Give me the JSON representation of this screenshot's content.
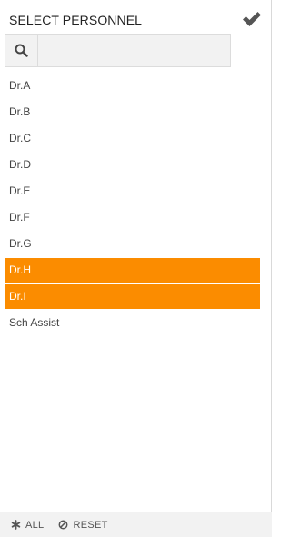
{
  "header": {
    "title": "SELECT PERSONNEL",
    "confirm_icon": "checkmark-icon"
  },
  "search": {
    "icon": "search-icon",
    "value": "",
    "placeholder": ""
  },
  "personnel": [
    {
      "label": "Dr.A",
      "selected": false
    },
    {
      "label": "Dr.B",
      "selected": false
    },
    {
      "label": "Dr.C",
      "selected": false
    },
    {
      "label": "Dr.D",
      "selected": false
    },
    {
      "label": "Dr.E",
      "selected": false
    },
    {
      "label": "Dr.F",
      "selected": false
    },
    {
      "label": "Dr.G",
      "selected": false
    },
    {
      "label": "Dr.H",
      "selected": true
    },
    {
      "label": "Dr.I",
      "selected": true
    },
    {
      "label": "Sch Assist",
      "selected": false
    }
  ],
  "footer": {
    "all_label": "ALL",
    "all_icon": "asterisk-icon",
    "reset_label": "RESET",
    "reset_icon": "ban-icon"
  },
  "colors": {
    "selected_bg": "#fb8c00",
    "selected_text": "#ffffff"
  }
}
